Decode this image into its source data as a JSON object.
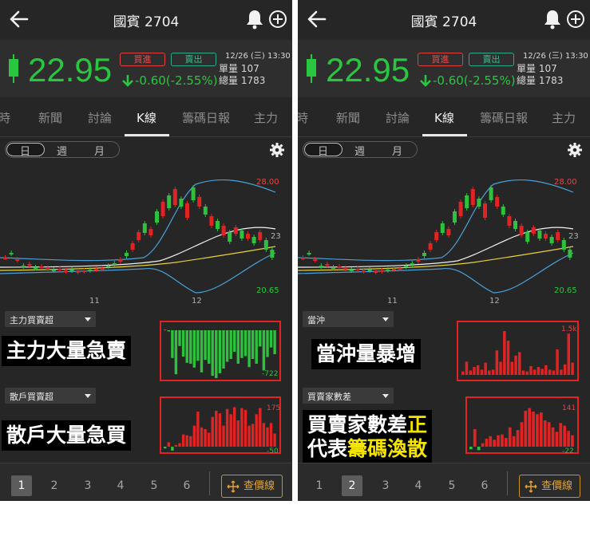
{
  "app": {
    "title": "國賓 2704",
    "price": "22.95",
    "change": "-0.60(-2.55%)",
    "buy_label": "買進",
    "sell_label": "賣出",
    "datetime": "12/26 (三) 13:30",
    "single_volume": "單量 107",
    "total_volume": "總量 1783"
  },
  "tabs": [
    "時",
    "新聞",
    "討論",
    "K線",
    "籌碼日報",
    "主力"
  ],
  "active_tab": "K線",
  "periods": [
    "日",
    "週",
    "月"
  ],
  "selected_period": "日",
  "chart_data": {
    "type": "candlestick",
    "price_axis_labels": [
      "28.00",
      "20.65"
    ],
    "overlap_label": "23",
    "x_tick_labels": [
      "11",
      "12"
    ],
    "overlays": [
      "bollinger-bands",
      "moving-average-white",
      "moving-average-yellow"
    ]
  },
  "panels": [
    {
      "ind1_label": "主力買賣超",
      "ind1_callout": "主力大量急賣",
      "ind1_max_label": "",
      "ind1_min_label": "-722",
      "ind1_values": [
        2,
        -2,
        -58,
        -92,
        -33,
        -55,
        -68,
        -70,
        -78,
        -64,
        -88,
        -62,
        -70,
        -95,
        -100,
        -90,
        -80,
        -66,
        -60,
        -45,
        -70,
        -58,
        -54,
        -77,
        -60,
        -70,
        -34,
        -84,
        -56,
        -36,
        -50
      ],
      "ind2_label": "散戶買賣超",
      "ind2_callout": "散戶大量急買",
      "ind2_max_label": "175",
      "ind2_min_label": "-50",
      "ind2_values": [
        -4,
        10,
        -9,
        4,
        8,
        28,
        26,
        24,
        48,
        80,
        44,
        40,
        32,
        68,
        82,
        76,
        48,
        86,
        74,
        90,
        60,
        88,
        84,
        48,
        52,
        74,
        88,
        54,
        44,
        54,
        30
      ],
      "active_page": "1"
    },
    {
      "ind1_label": "當沖",
      "ind1_callout": "當沖量暴增",
      "ind1_max_label": "1.5k",
      "ind1_min_label": "",
      "ind1_values": [
        8,
        30,
        10,
        18,
        22,
        12,
        28,
        10,
        12,
        56,
        30,
        100,
        78,
        30,
        44,
        52,
        10,
        8,
        20,
        12,
        18,
        14,
        22,
        12,
        10,
        58,
        12,
        24,
        94,
        28
      ],
      "ind2_label": "買賣家數差",
      "ind2_callout_line1": "買賣家數差",
      "ind2_callout_highlight1": "正",
      "ind2_callout_line2": "代表",
      "ind2_callout_highlight2": "籌碼渙散",
      "ind2_max_label": "141",
      "ind2_min_label": "-22",
      "ind2_values": [
        -6,
        40,
        -8,
        8,
        18,
        24,
        16,
        26,
        28,
        20,
        44,
        24,
        38,
        56,
        82,
        88,
        80,
        74,
        78,
        60,
        56,
        44,
        34,
        54,
        48,
        36,
        26
      ],
      "active_page": "2"
    }
  ],
  "footer": {
    "pages": [
      "1",
      "2",
      "3",
      "4",
      "5",
      "6"
    ],
    "price_line_label": "查價線"
  },
  "colors": {
    "up": "#e02424",
    "down": "#29c640",
    "accent": "#e6a52f",
    "panel_bg": "#262626"
  }
}
